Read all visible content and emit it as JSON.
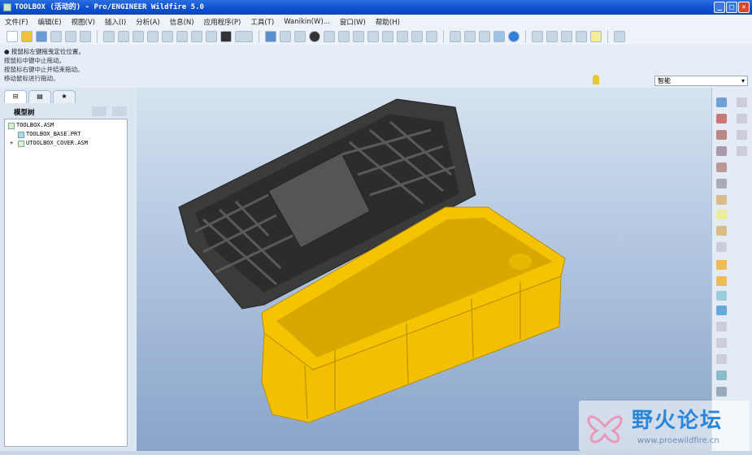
{
  "window": {
    "title": "TOOLBOX (活动的) - Pro/ENGINEER Wildfire 5.0",
    "controls": [
      "_",
      "□",
      "✕"
    ]
  },
  "menu": [
    "文件(F)",
    "编辑(E)",
    "视图(V)",
    "插入(I)",
    "分析(A)",
    "信息(N)",
    "应用程序(P)",
    "工具(T)",
    "Wanikin(W)...",
    "窗口(W)",
    "帮助(H)"
  ],
  "messages": [
    "● 按鼠标左键拖曳定位位置。",
    "按鼠标中键中止拖动。",
    "按鼠标右键中止并结束拖动。",
    "移动鼠标进行拖动。"
  ],
  "filter": {
    "value": "智能"
  },
  "left_panel": {
    "title": "模型树",
    "tree": [
      {
        "label": "TOOLBOX.ASM",
        "expand": ""
      },
      {
        "label": "TOOLBOX_BASE.PRT",
        "expand": ""
      },
      {
        "label": "UTOOLBOX_COVER.ASM",
        "expand": "+"
      }
    ]
  },
  "watermark": {
    "title": "野火论坛",
    "url": "www.proewildfire.cn"
  },
  "colors": {
    "lid": "#3a3a3a",
    "box": "#f2c200",
    "titlebar": "#0b4fd0"
  }
}
